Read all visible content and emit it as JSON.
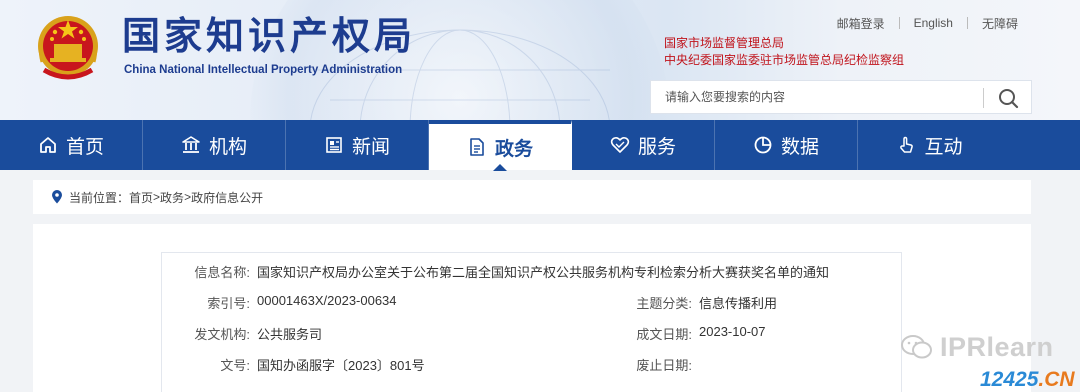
{
  "header": {
    "title_cn": "国家知识产权局",
    "title_en": "China National Intellectual Property Administration",
    "top_links": [
      "邮箱登录",
      "English",
      "无障碍"
    ],
    "orgs": [
      "国家市场监督管理总局",
      "中央纪委国家监委驻市场监管总局纪检监察组"
    ],
    "search_placeholder": "请输入您要搜索的内容",
    "emblem": "national-emblem-icon"
  },
  "nav": {
    "active_index": 3,
    "items": [
      {
        "label": "首页",
        "icon": "home-icon"
      },
      {
        "label": "机构",
        "icon": "institution-icon"
      },
      {
        "label": "新闻",
        "icon": "newspaper-icon"
      },
      {
        "label": "政务",
        "icon": "document-icon"
      },
      {
        "label": "服务",
        "icon": "heart-handshake-icon"
      },
      {
        "label": "数据",
        "icon": "pie-chart-icon"
      },
      {
        "label": "互动",
        "icon": "hand-pointer-icon"
      }
    ]
  },
  "breadcrumb": {
    "prefix": "当前位置：",
    "items": [
      "首页",
      "政务",
      "政府信息公开"
    ],
    "separator": ">"
  },
  "info": {
    "name_label": "信息名称:",
    "name_value": "国家知识产权局办公室关于公布第二届全国知识产权公共服务机构专利检索分析大赛获奖名单的通知",
    "index_label": "索引号:",
    "index_value": "00001463X/2023-00634",
    "topic_label": "主题分类:",
    "topic_value": "信息传播利用",
    "org_label": "发文机构:",
    "org_value": "公共服务司",
    "date_label": "成文日期:",
    "date_value": "2023-10-07",
    "docno_label": "文号:",
    "docno_value": "国知办函服字〔2023〕801号",
    "abolish_label": "废止日期:",
    "abolish_value": ""
  },
  "watermark": {
    "brand": "IPRlearn",
    "site_num": "12425",
    "site_tld": ".CN"
  },
  "colors": {
    "nav_bg": "#1a4c9c",
    "title": "#1d3c8f",
    "org_red": "#c0131b"
  }
}
